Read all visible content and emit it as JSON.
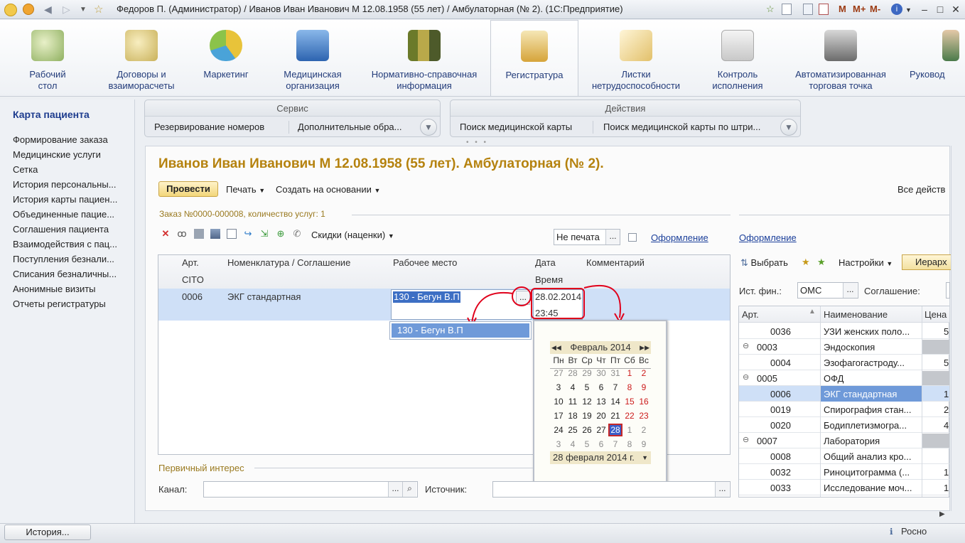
{
  "window": {
    "title": "Федоров П. (Администратор) / Иванов Иван Иванович М 12.08.1958 (55 лет) / Амбулаторная (№ 2).  (1С:Предприятие)",
    "title_buttons": [
      "M",
      "M+",
      "M-"
    ]
  },
  "sections": [
    {
      "label": "Рабочий\nстол",
      "icon": "desk-lamp-icon",
      "color": "#8fb060"
    },
    {
      "label": "Договоры и\nвзаиморасчеты",
      "icon": "coins-icon",
      "color": "#c9b15a"
    },
    {
      "label": "Маркетинг",
      "icon": "pie-chart-icon",
      "color": "#e8c33a"
    },
    {
      "label": "Медицинская\nорганизация",
      "icon": "building-icon",
      "color": "#4a83c8"
    },
    {
      "label": "Нормативно-справочная\nинформация",
      "icon": "binders-icon",
      "color": "#8a8a3a"
    },
    {
      "label": "Регистратура",
      "icon": "clipboard-question-icon",
      "color": "#d6a43a",
      "active": true
    },
    {
      "label": "Листки\nнетрудоспособности",
      "icon": "sheets-icon",
      "color": "#e2c06a"
    },
    {
      "label": "Контроль\nисполнения",
      "icon": "first-aid-kit-icon",
      "color": "#c8c8c8"
    },
    {
      "label": "Автоматизированная\nторговая точка",
      "icon": "cash-register-icon",
      "color": "#7a7a7a"
    },
    {
      "label": "Руковод",
      "icon": "manager-icon",
      "color": "#4a7a4a"
    }
  ],
  "leftnav": {
    "header": "Карта пациента",
    "items": [
      "Формирование заказа",
      "Медицинские услуги",
      "Сетка",
      "История персональны...",
      "История карты пациен...",
      "Объединенные пацие...",
      "Соглашения пациента",
      "Взаимодействия с пац...",
      "Поступления безнали...",
      "Списания безналичны...",
      "Анонимные визиты",
      "Отчеты регистратуры"
    ]
  },
  "service_panel": {
    "title": "Сервис",
    "items": [
      "Резервирование номеров",
      "Дополнительные обра..."
    ]
  },
  "actions_panel": {
    "title": "Действия",
    "items": [
      "Поиск медицинской карты",
      "Поиск медицинской карты по штри..."
    ]
  },
  "form": {
    "heading": "Иванов Иван Иванович М 12.08.1958 (55 лет). Амбулаторная (№ 2).",
    "toolbar": {
      "post": "Провести",
      "print": "Печать",
      "create_based": "Создать на основании",
      "all_actions": "Все действ"
    },
    "order_caption": "Заказ №0000-000008, количество услуг: 1",
    "discounts": "Скидки (наценки)",
    "print_status": "Не печата",
    "link_formalize": "Оформление",
    "grid": {
      "headers": [
        "Арт.",
        "Номенклатура / Соглашение",
        "Рабочее место",
        "Дата",
        "Комментарий"
      ],
      "subheaders": [
        "CITO",
        "Время"
      ],
      "row": {
        "art": "0006",
        "name": "ЭКГ стандартная",
        "workplace": "130 - Бегун В.П",
        "date": "28.02.2014",
        "time": "23:45"
      }
    },
    "dropdown_option": "130 - Бегун В.П",
    "primary_interest": "Первичный интерес",
    "channel_label": "Канал:",
    "source_label": "Источник:"
  },
  "calendar": {
    "month": "Февраль 2014",
    "dows": [
      "Пн",
      "Вт",
      "Ср",
      "Чт",
      "Пт",
      "Сб",
      "Вс"
    ],
    "weeks": [
      [
        "27",
        "28",
        "29",
        "30",
        "31",
        "1",
        "2"
      ],
      [
        "3",
        "4",
        "5",
        "6",
        "7",
        "8",
        "9"
      ],
      [
        "10",
        "11",
        "12",
        "13",
        "14",
        "15",
        "16"
      ],
      [
        "17",
        "18",
        "19",
        "20",
        "21",
        "22",
        "23"
      ],
      [
        "24",
        "25",
        "26",
        "27",
        "28",
        "1",
        "2"
      ],
      [
        "3",
        "4",
        "5",
        "6",
        "7",
        "8",
        "9"
      ]
    ],
    "footer": "28 февраля 2014 г."
  },
  "right_panel": {
    "link_formalize": "Оформление",
    "select": "Выбрать",
    "settings": "Настройки",
    "hierarchy": "Иерарх",
    "fin_source_label": "Ист. фин.:",
    "fin_source_value": "ОМС",
    "agreement_label": "Соглашение:",
    "headers": [
      "Арт.",
      "Наименование",
      "Цена"
    ],
    "rows": [
      {
        "art": "0036",
        "name": "УЗИ женских поло...",
        "price": "5",
        "group": false
      },
      {
        "art": "0003",
        "name": "Эндоскопия",
        "price": "",
        "group": true
      },
      {
        "art": "0004",
        "name": "Эзофагогастроду...",
        "price": "5",
        "group": false
      },
      {
        "art": "0005",
        "name": "ОФД",
        "price": "",
        "group": true
      },
      {
        "art": "0006",
        "name": "ЭКГ стандартная",
        "price": "1",
        "group": false,
        "selected": true
      },
      {
        "art": "0019",
        "name": "Спирография стан...",
        "price": "2",
        "group": false
      },
      {
        "art": "0020",
        "name": "Бодиплетизмогра...",
        "price": "4",
        "group": false
      },
      {
        "art": "0007",
        "name": "Лаборатория",
        "price": "",
        "group": true
      },
      {
        "art": "0008",
        "name": "Общий анализ кро...",
        "price": "",
        "group": false
      },
      {
        "art": "0032",
        "name": "Риноцитограмма (...",
        "price": "1",
        "group": false
      },
      {
        "art": "0033",
        "name": "Исследование моч...",
        "price": "1",
        "group": false
      }
    ]
  },
  "statusbar": {
    "history": "История...",
    "retail": "Росно"
  }
}
